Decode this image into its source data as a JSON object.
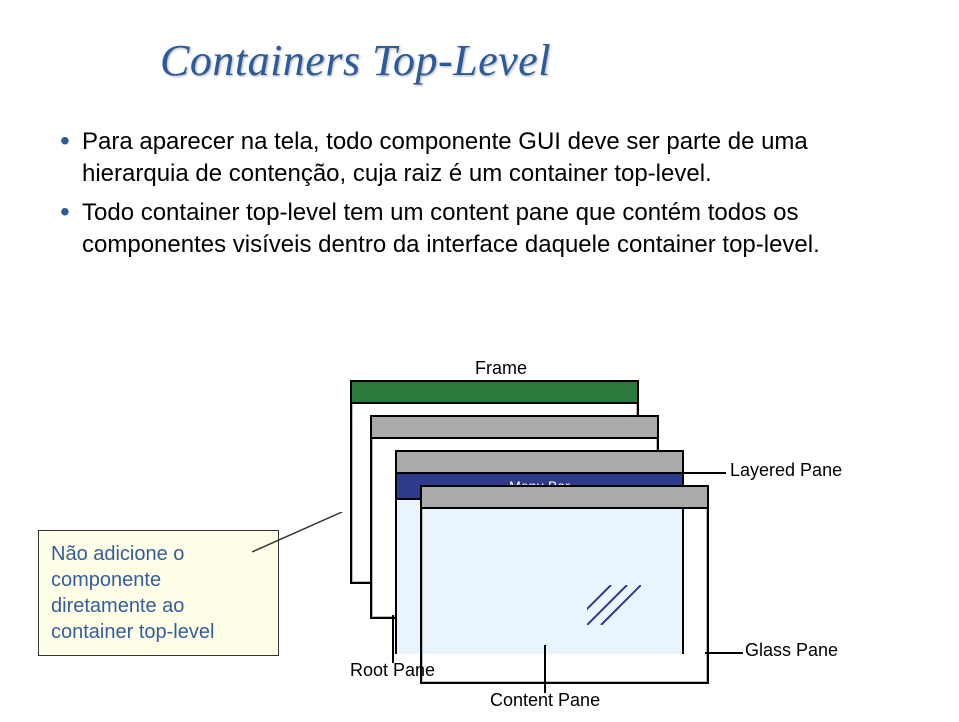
{
  "title": "Containers Top-Level",
  "bullets": [
    "Para aparecer na tela, todo componente GUI deve ser parte de uma hierarquia de contenção, cuja raiz é um container top-level.",
    "Todo container top-level tem um content pane que contém todos os componentes visíveis dentro da interface daquele container top-level."
  ],
  "callout": "Não adicione o componente diretamente ao container top-level",
  "diagram": {
    "frame_label": "Frame",
    "menubar_label": "Menu Bar",
    "content_hatch": "(content area hatching)",
    "pointer_root": "Root Pane",
    "pointer_content": "Content Pane",
    "pointer_layered": "Layered Pane",
    "pointer_glass": "Glass Pane"
  }
}
